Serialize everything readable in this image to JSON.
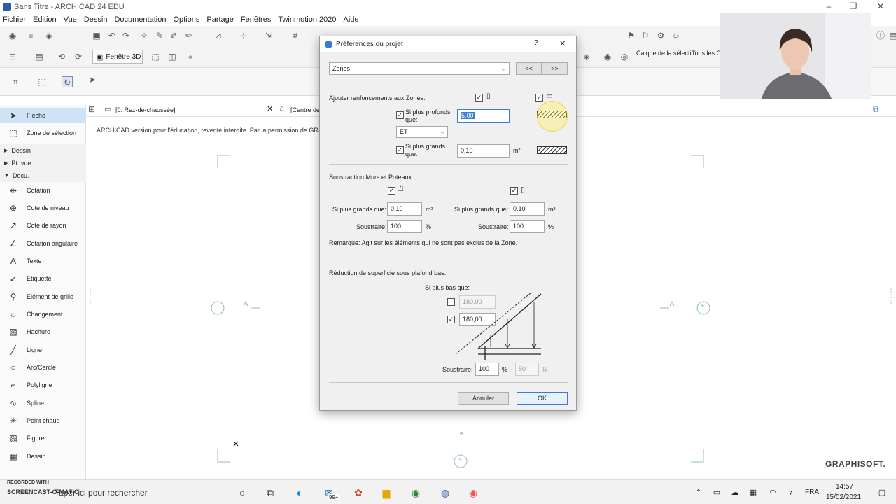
{
  "window": {
    "title": "Sans Titre - ARCHICAD 24 EDU"
  },
  "menu": [
    "Fichier",
    "Edition",
    "Vue",
    "Dessin",
    "Documentation",
    "Options",
    "Partage",
    "Fenêtres",
    "Twinmotion 2020",
    "Aide"
  ],
  "toolbar": {
    "fenetre3d_label": "Fenêtre 3D",
    "calque_label": "Calque de la sélecti",
    "tous_label": "Tous les C"
  },
  "palette": {
    "items_top": [
      "Flèche",
      "Zone de sélection"
    ],
    "groups": [
      "Dessin",
      "Pt. vue",
      "Docu."
    ],
    "items": [
      "Cotation",
      "Cote de niveau",
      "Cote de rayon",
      "Cotation angulaire",
      "Texte",
      "Etiquette",
      "Elément de grille",
      "Changement",
      "Hachure",
      "Ligne",
      "Arc/Cercle",
      "Polyligne",
      "Spline",
      "Point chaud",
      "Figure",
      "Dessin"
    ]
  },
  "tabs": {
    "tab1": "[0. Rez-de-chaussée]",
    "tab2": "[Centre de"
  },
  "canvas": {
    "watermark": "ARCHICAD version pour l'éducation, revente interdite. Par la permission de GRA",
    "marker_left": "0",
    "marker_right": "E",
    "marker_bottom": "S",
    "marker_b": "B",
    "label_a_left": "A",
    "label_a_right": "A",
    "brand": "GRAPHISOFT."
  },
  "dialog": {
    "title": "Préférences du projet",
    "help": "?",
    "close": "✕",
    "category": "Zones",
    "prev": "<<",
    "next": ">>",
    "ajouter_label": "Ajouter renfoncements aux Zones:",
    "plus_profonds_label": "Si plus profonds que:",
    "plus_profonds_value": "5,00",
    "operator": "ET",
    "plus_grands_label": "Si plus grands que:",
    "plus_grands_value": "0,10",
    "unit_m2": "m²",
    "soustraction_label": "Soustraction Murs et Poteaux:",
    "murs": {
      "plus_grands_label": "Si plus grands que:",
      "plus_grands_value": "0,10",
      "soustraire_label": "Soustraire:",
      "soustraire_value": "100",
      "unit_pct": "%"
    },
    "poteaux": {
      "plus_grands_label": "Si plus grands que:",
      "plus_grands_value": "0,10",
      "soustraire_label": "Soustraire:",
      "soustraire_value": "100",
      "unit_pct": "%"
    },
    "remarque": "Remarque: Agit sur les éléments qui ne sont pas exclus de la Zone.",
    "reduction_label": "Réduction de superficie sous plafond bas:",
    "si_plus_bas_label": "Si plus bas que:",
    "height1_value": "180,00",
    "height2_value": "180,00",
    "soustraire2_label": "Soustraire:",
    "soustraire2_value": "100",
    "soustraire3_value": "50",
    "cancel": "Annuler",
    "ok": "OK"
  },
  "taskbar": {
    "search": "Taper ici pour rechercher",
    "badge": "99+",
    "lang": "FRA",
    "time": "14:57",
    "date": "15/02/2021",
    "recorded": "RECORDED WITH",
    "screencast": "SCREENCAST-O-MATIC"
  }
}
